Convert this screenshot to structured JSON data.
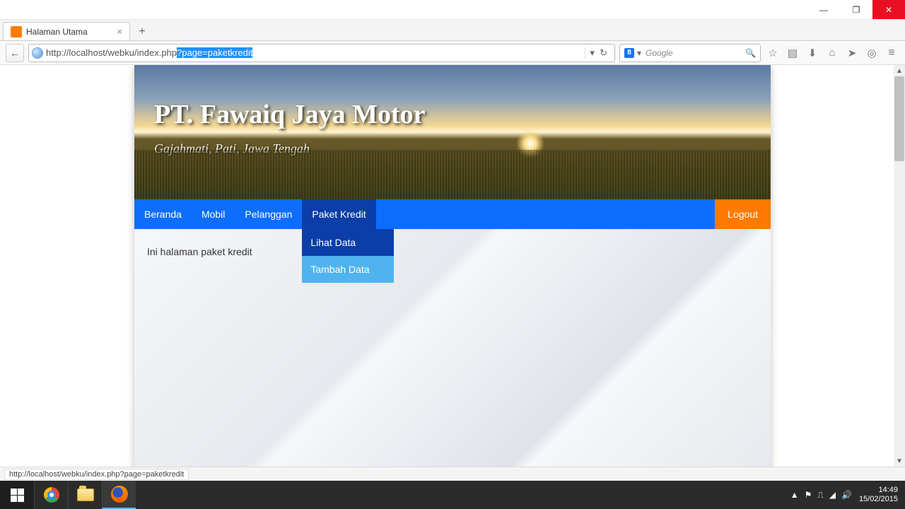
{
  "window": {
    "minimize": "—",
    "maximize": "❐",
    "close": "✕"
  },
  "tab": {
    "title": "Halaman Utama",
    "close": "×",
    "new": "+"
  },
  "url": {
    "back": "←",
    "plain": "http://localhost/webku/index.php",
    "selected": "?page=paketkredit",
    "refresh": "↻"
  },
  "search": {
    "engine": "8",
    "placeholder": "Google",
    "arrow": "▾",
    "go": "🔍"
  },
  "toolbar": {
    "star": "☆",
    "clipboard": "▤",
    "download": "⬇",
    "home": "⌂",
    "plane": "➤",
    "reader": "◎",
    "menu": "≡"
  },
  "hero": {
    "title": "PT. Fawaiq Jaya Motor",
    "subtitle": "Gajahmati, Pati, Jawa Tengah"
  },
  "nav": {
    "beranda": "Beranda",
    "mobil": "Mobil",
    "pelanggan": "Pelanggan",
    "paketkredit": "Paket Kredit",
    "logout": "Logout",
    "dropdown": {
      "lihat": "Lihat Data",
      "tambah": "Tambah Data"
    }
  },
  "content": {
    "text": "Ini halaman paket kredit"
  },
  "status": {
    "text": "http://localhost/webku/index.php?page=paketkredit"
  },
  "systray": {
    "up": "▲",
    "flag": "⚑",
    "net": "⎍",
    "wifi": "◢",
    "vol": "🔊",
    "time": "14:49",
    "date": "15/02/2015"
  },
  "scroll": {
    "up": "▲",
    "down": "▼"
  }
}
